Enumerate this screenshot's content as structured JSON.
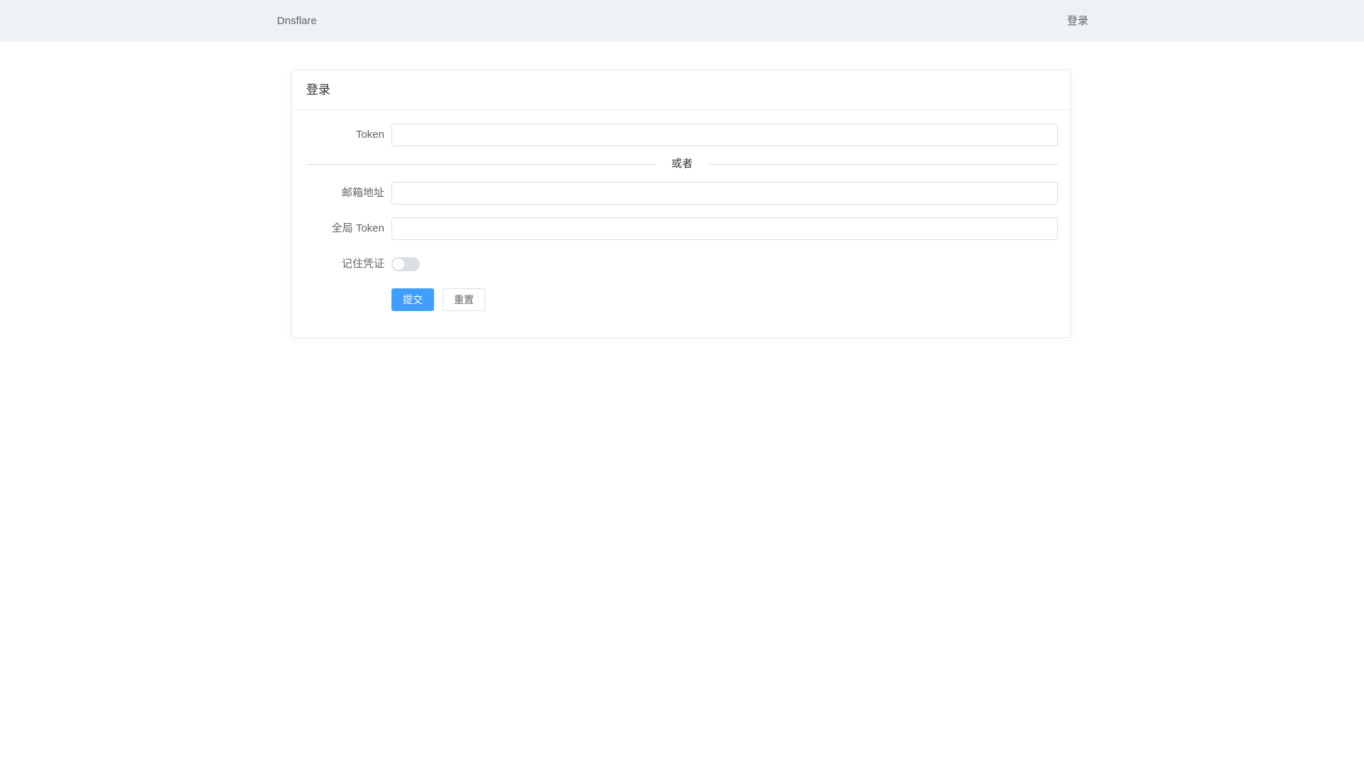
{
  "header": {
    "brand": "Dnsflare",
    "login_link": "登录"
  },
  "card": {
    "title": "登录",
    "token": {
      "label": "Token",
      "value": "",
      "placeholder": ""
    },
    "divider_text": "或者",
    "email": {
      "label": "邮箱地址",
      "value": "",
      "placeholder": ""
    },
    "global_token": {
      "label": "全局 Token",
      "value": "",
      "placeholder": ""
    },
    "remember": {
      "label": "记住凭证",
      "enabled": false
    },
    "buttons": {
      "submit": "提交",
      "reset": "重置"
    }
  },
  "colors": {
    "topbar_bg": "#eef1f6",
    "primary": "#409eff",
    "switch_off": "#dcdfe6"
  }
}
